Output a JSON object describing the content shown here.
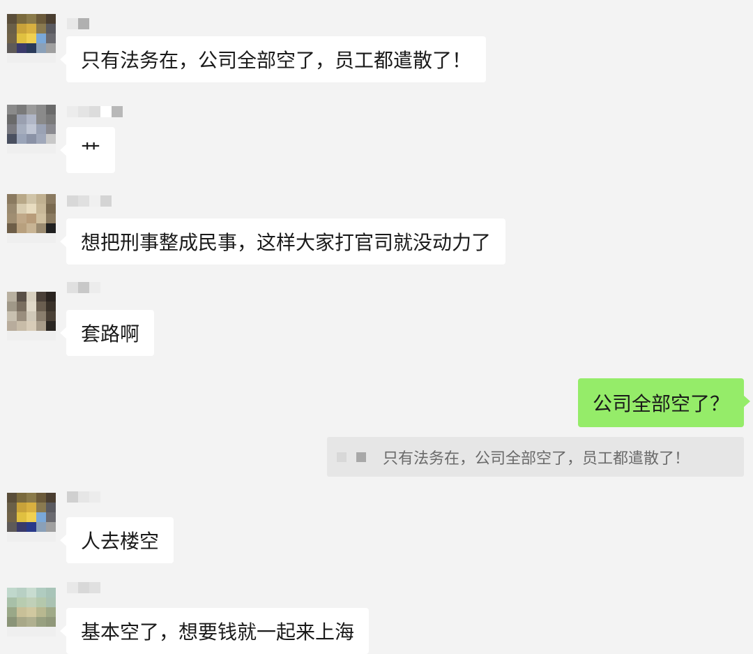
{
  "chat": {
    "messages": [
      {
        "text": "只有法务在，公司全部空了，员工都遣散了！"
      },
      {
        "text": "艹"
      },
      {
        "text": "想把刑事整成民事，这样大家打官司就没动力了"
      },
      {
        "text": "套路啊"
      },
      {
        "text": "公司全部空了？"
      },
      {
        "text": "人去楼空"
      },
      {
        "text": "基本空了，想要钱就一起来上海"
      }
    ],
    "quoted_reply": {
      "text": "只有法务在，公司全部空了，员工都遣散了！"
    }
  },
  "colors": {
    "background": "#f3f3f3",
    "incoming_bubble": "#ffffff",
    "outgoing_bubble": "#95ec69",
    "quote_box": "#e6e6e6"
  }
}
